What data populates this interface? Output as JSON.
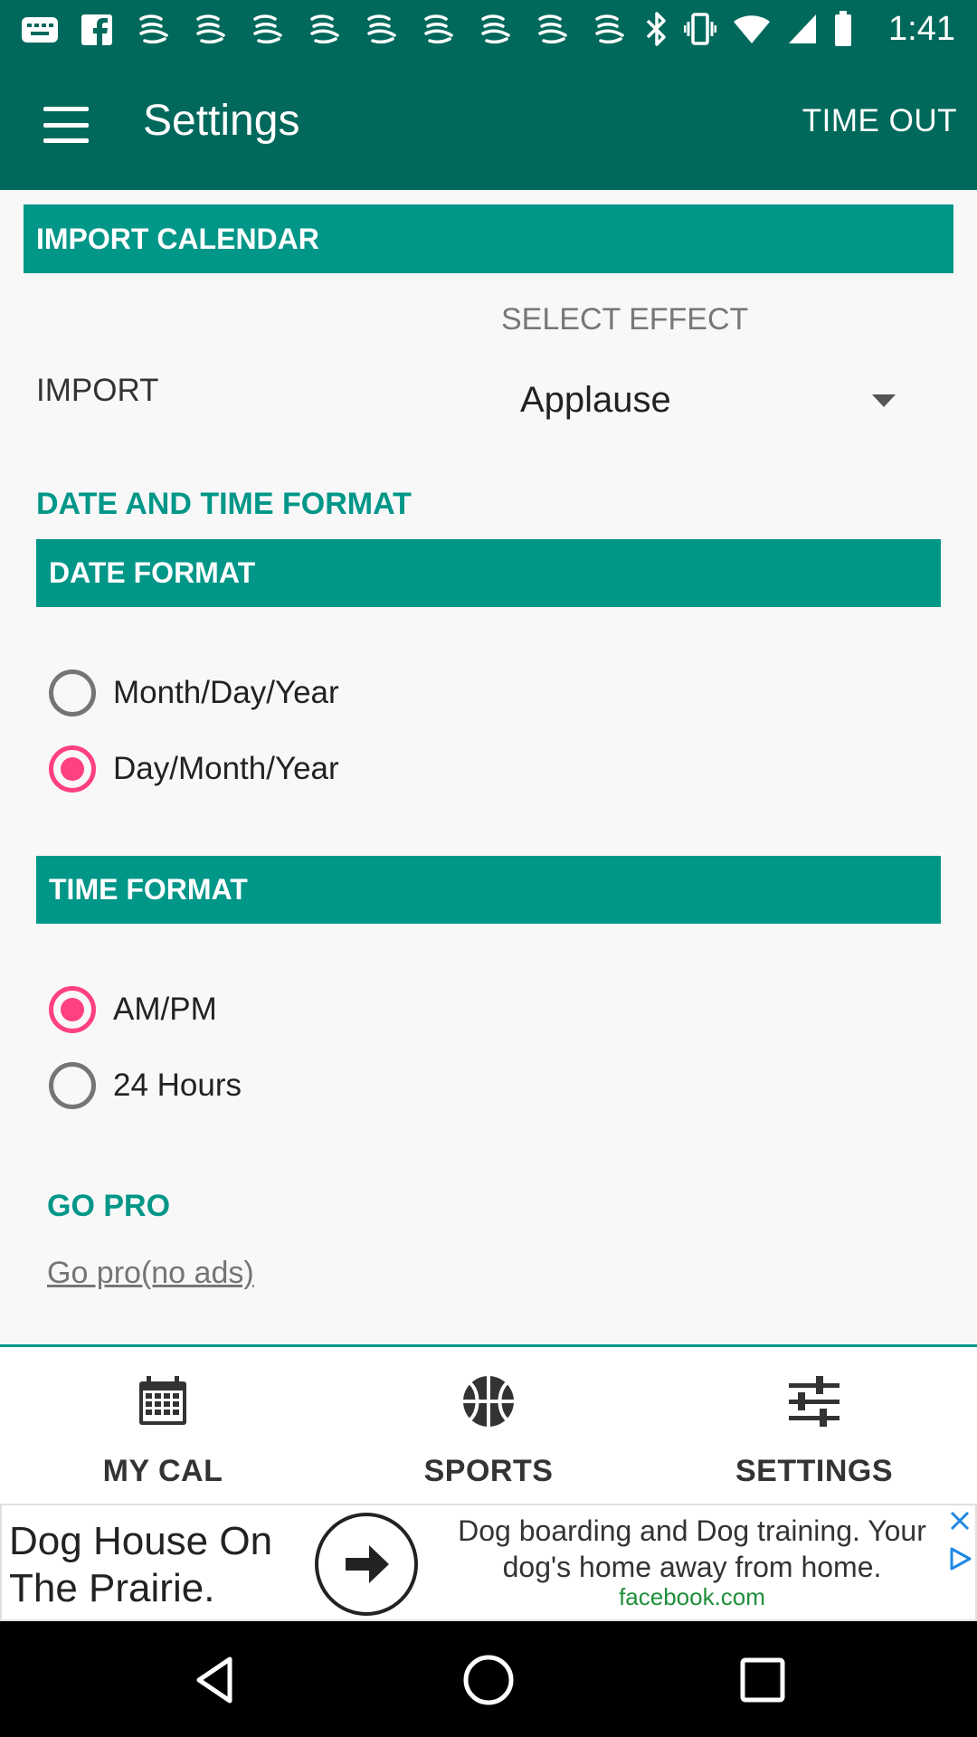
{
  "status_bar": {
    "time": "1:41",
    "notification_icons": [
      "photos-icon",
      "facebook-icon",
      "shoe-icon",
      "shoe-icon",
      "shoe-icon",
      "shoe-icon",
      "shoe-icon",
      "shoe-icon",
      "shoe-icon",
      "shoe-icon",
      "shoe-icon"
    ],
    "right_icons": [
      "bluetooth-icon",
      "vibrate-icon",
      "wifi-icon",
      "cell-signal-icon",
      "battery-icon"
    ]
  },
  "app_bar": {
    "title": "Settings",
    "action_label": "TIME OUT",
    "background": "#00695c"
  },
  "import_section": {
    "header": "IMPORT CALENDAR",
    "import_label": "IMPORT",
    "select_effect_label": "SELECT EFFECT",
    "selected_effect": "Applause"
  },
  "date_time_section": {
    "title": "DATE AND TIME FORMAT",
    "date_format": {
      "header": "DATE FORMAT",
      "options": [
        {
          "label": "Month/Day/Year",
          "checked": false
        },
        {
          "label": "Day/Month/Year",
          "checked": true
        }
      ]
    },
    "time_format": {
      "header": "TIME FORMAT",
      "options": [
        {
          "label": "AM/PM",
          "checked": true
        },
        {
          "label": "24 Hours",
          "checked": false
        }
      ]
    }
  },
  "go_pro": {
    "title": "GO PRO",
    "link": "Go pro(no ads)"
  },
  "bottom_nav": {
    "items": [
      {
        "label": "MY CAL",
        "icon": "calendar-icon"
      },
      {
        "label": "SPORTS",
        "icon": "basketball-icon"
      },
      {
        "label": "SETTINGS",
        "icon": "sliders-icon"
      }
    ]
  },
  "ad": {
    "title": "Dog House On The Prairie.",
    "description": "Dog boarding and Dog training. Your dog's home away from home.",
    "domain": "facebook.com"
  },
  "colors": {
    "primary_dark": "#00695c",
    "accent_teal": "#009688",
    "radio_accent": "#ff4081"
  }
}
